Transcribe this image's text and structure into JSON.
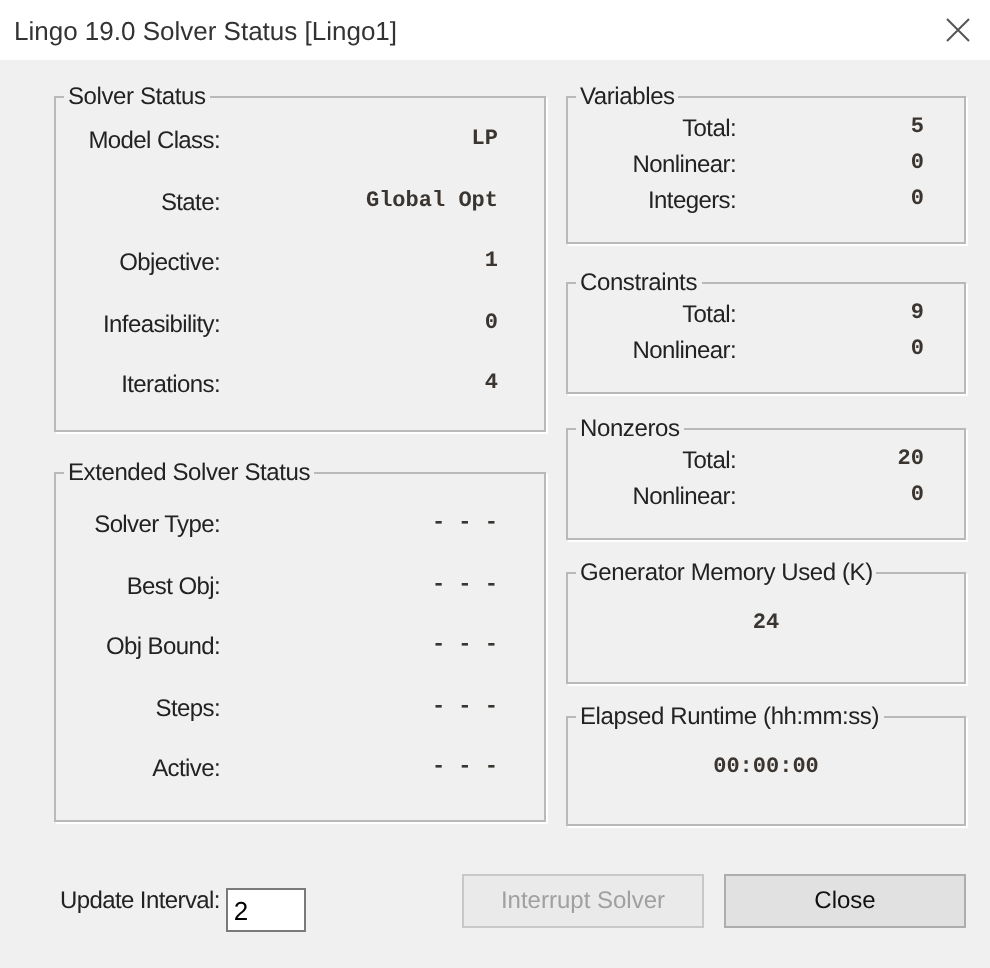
{
  "window": {
    "title": "Lingo 19.0 Solver Status [Lingo1]"
  },
  "solver_status": {
    "title": "Solver Status",
    "rows": [
      {
        "label": "Model Class:",
        "value": "LP"
      },
      {
        "label": "State:",
        "value": "Global Opt"
      },
      {
        "label": "Objective:",
        "value": "1"
      },
      {
        "label": "Infeasibility:",
        "value": "0"
      },
      {
        "label": "Iterations:",
        "value": "4"
      }
    ]
  },
  "extended_solver_status": {
    "title": "Extended Solver Status",
    "rows": [
      {
        "label": "Solver Type:",
        "value": "- - -"
      },
      {
        "label": "Best Obj:",
        "value": "- - -"
      },
      {
        "label": "Obj Bound:",
        "value": "- - -"
      },
      {
        "label": "Steps:",
        "value": "- - -"
      },
      {
        "label": "Active:",
        "value": "- - -"
      }
    ]
  },
  "variables": {
    "title": "Variables",
    "rows": [
      {
        "label": "Total:",
        "value": "5"
      },
      {
        "label": "Nonlinear:",
        "value": "0"
      },
      {
        "label": "Integers:",
        "value": "0"
      }
    ]
  },
  "constraints": {
    "title": "Constraints",
    "rows": [
      {
        "label": "Total:",
        "value": "9"
      },
      {
        "label": "Nonlinear:",
        "value": "0"
      }
    ]
  },
  "nonzeros": {
    "title": "Nonzeros",
    "rows": [
      {
        "label": "Total:",
        "value": "20"
      },
      {
        "label": "Nonlinear:",
        "value": "0"
      }
    ]
  },
  "generator_memory": {
    "title": "Generator Memory Used (K)",
    "value": "24"
  },
  "elapsed_runtime": {
    "title": "Elapsed Runtime (hh:mm:ss)",
    "value": "00:00:00"
  },
  "update_interval": {
    "label": "Update Interval:",
    "value": "2"
  },
  "buttons": [
    {
      "label": "Interrupt Solver",
      "disabled": true
    },
    {
      "label": "Close",
      "disabled": false
    }
  ]
}
